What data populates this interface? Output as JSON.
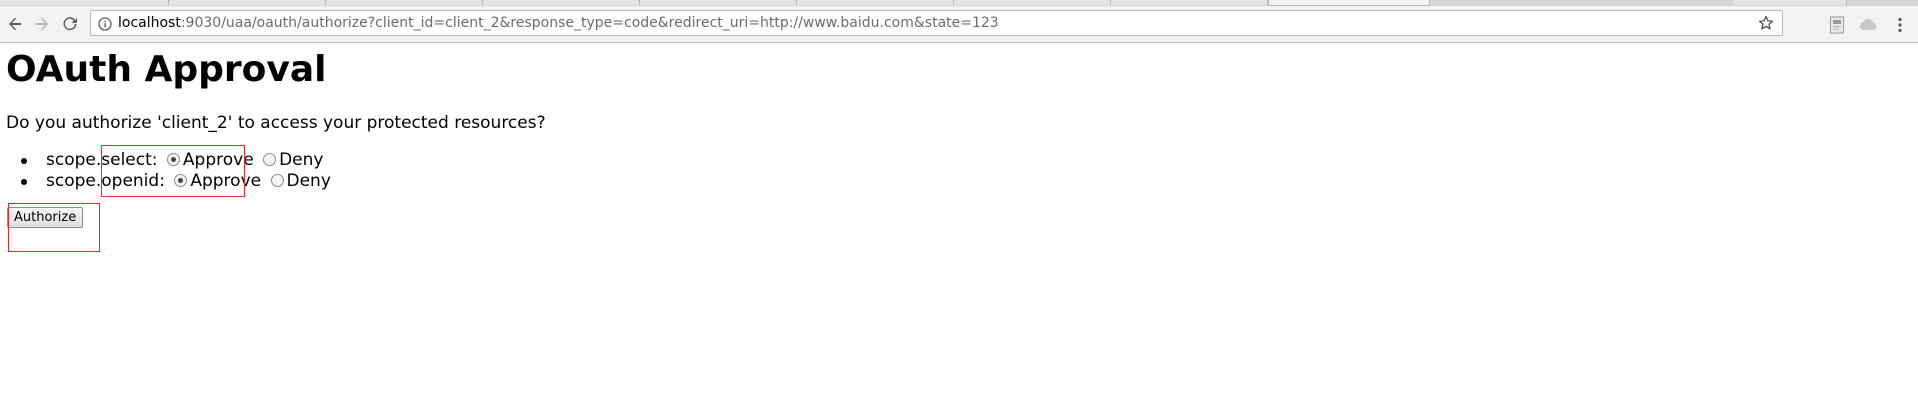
{
  "browser": {
    "url_host": "localhost",
    "url_path": ":9030/uaa/oauth/authorize?client_id=client_2&response_type=code&redirect_uri=http://www.baidu.com&state=123",
    "icons": {
      "back": "arrow-left-icon",
      "forward": "arrow-right-icon",
      "reload": "reload-icon",
      "info": "info-icon",
      "bookmark": "star-icon",
      "extension1": "pdf-extension-icon",
      "extension2": "cloud-extension-icon",
      "menu": "kebab-menu-icon"
    }
  },
  "page": {
    "title": "OAuth Approval",
    "question": "Do you authorize 'client_2' to access your protected resources?",
    "scopes": [
      {
        "name": "scope.select:",
        "approve_label": "Approve",
        "deny_label": "Deny",
        "selected": "approve"
      },
      {
        "name": "scope.openid:",
        "approve_label": "Approve",
        "deny_label": "Deny",
        "selected": "approve"
      }
    ],
    "authorize_button": "Authorize"
  },
  "colors": {
    "annotation_border": "#e8232a",
    "toolbar_bg": "#f2f2f2"
  }
}
